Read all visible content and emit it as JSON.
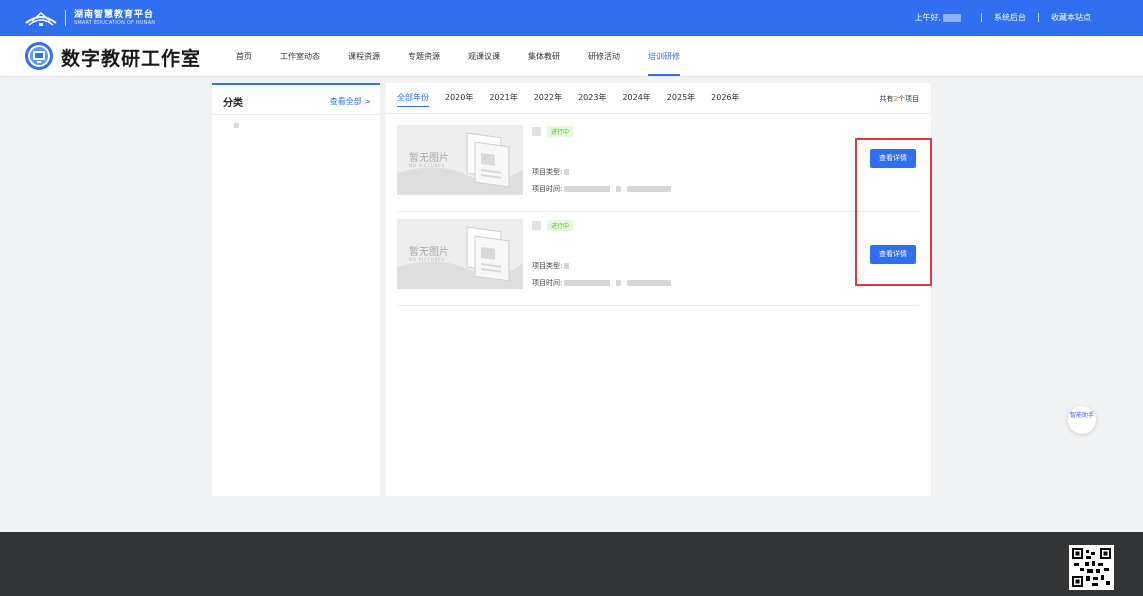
{
  "topbar": {
    "brand_cn": "湖南智慧教育平台",
    "brand_en": "SMART EDUCATION OF HUNAN",
    "greeting": "上午好,",
    "system_backend": "系统后台",
    "bookmark": "收藏本站点"
  },
  "header": {
    "site_title": "数字教研工作室",
    "nav": [
      {
        "label": "首页"
      },
      {
        "label": "工作室动态"
      },
      {
        "label": "课程资源"
      },
      {
        "label": "专题资源"
      },
      {
        "label": "观课议课"
      },
      {
        "label": "集体教研"
      },
      {
        "label": "研修活动"
      },
      {
        "label": "培训研修"
      }
    ],
    "active_nav": "培训研修"
  },
  "category": {
    "title": "分类",
    "view_all": "查看全部 >"
  },
  "main": {
    "year_tabs": [
      {
        "label": "全部年份"
      },
      {
        "label": "2020年"
      },
      {
        "label": "2021年"
      },
      {
        "label": "2022年"
      },
      {
        "label": "2023年"
      },
      {
        "label": "2024年"
      },
      {
        "label": "2025年"
      },
      {
        "label": "2026年"
      }
    ],
    "active_year": "全部年份",
    "total_prefix": "共有",
    "total_count": "2",
    "total_suffix": "个项目",
    "items": [
      {
        "thumb_text": "暂无图片",
        "thumb_sub": "NO PICTURES",
        "status": "进行中",
        "type_label": "项目类型:",
        "time_label": "项目时间:",
        "detail_label": "查看详情"
      },
      {
        "thumb_text": "暂无图片",
        "thumb_sub": "NO PICTURES",
        "status": "进行中",
        "type_label": "项目类型:",
        "time_label": "项目时间:",
        "detail_label": "查看详情"
      }
    ]
  },
  "float_button": {
    "label": "智能助手"
  },
  "colors": {
    "brand_blue": "#2f6ff0",
    "status_green": "#52c41a",
    "highlight_red": "#e53935",
    "count_orange": "#ff6a3d"
  },
  "icons": {
    "logo": "book-wing-icon",
    "emblem": "studio-emblem-icon",
    "qr": "qr-code-icon"
  }
}
